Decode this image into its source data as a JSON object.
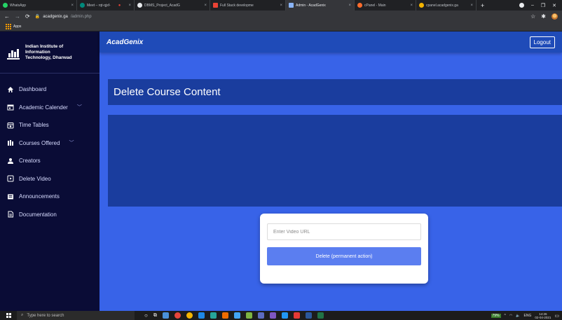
{
  "browser": {
    "tabs": [
      {
        "label": "WhatsApp",
        "color": "#25d366"
      },
      {
        "label": "Meet – rqt-qjsf-",
        "color": "#00897b"
      },
      {
        "label": "DBMS_Project_AcadG",
        "color": "#e8eaed"
      },
      {
        "label": "Full Stack developme",
        "color": "#ea4335"
      },
      {
        "label": "Admin - AcadGenix",
        "color": "#8ab4f8"
      },
      {
        "label": "cPanel - Main",
        "color": "#ff6c2c"
      },
      {
        "label": "cpanel.acadgenix.ga",
        "color": "#f4b400"
      }
    ],
    "active_tab": 4,
    "address_host": "acadgenix.ga",
    "address_path": "/admin.php",
    "bookmarks_label": "Apps"
  },
  "sidebar": {
    "brand_line1": "Indian Institute of",
    "brand_line2": "Information",
    "brand_line3": "Technology, Dharwad",
    "items": [
      {
        "label": "Dashboard",
        "icon": "home-icon"
      },
      {
        "label": "Academic Calender",
        "icon": "calendar-icon",
        "has_chevron": true
      },
      {
        "label": "Time Tables",
        "icon": "timetable-icon"
      },
      {
        "label": "Courses Offered",
        "icon": "courses-icon",
        "has_chevron": true
      },
      {
        "label": "Creators",
        "icon": "creators-icon"
      },
      {
        "label": "Delete Video",
        "icon": "delete-video-icon"
      },
      {
        "label": "Announcements",
        "icon": "announcements-icon"
      },
      {
        "label": "Documentation",
        "icon": "documentation-icon"
      }
    ]
  },
  "header": {
    "app_name": "AcadGenix",
    "logout_label": "Logout"
  },
  "page": {
    "title": "Delete Course Content",
    "url_placeholder": "Enter Video URL",
    "delete_label": "Delete (permanent action)"
  },
  "taskbar": {
    "search_placeholder": "Type here to search",
    "battery": "79%",
    "language": "ENG",
    "time": "14:26",
    "date": "02-04-2021"
  },
  "colors": {
    "sidebar_bg": "#0a0c36",
    "main_bg": "#3863e8",
    "panel_bg": "#1a3d9e",
    "appbar_bg": "#1f4bb8",
    "button_bg": "#5b7ef0"
  }
}
